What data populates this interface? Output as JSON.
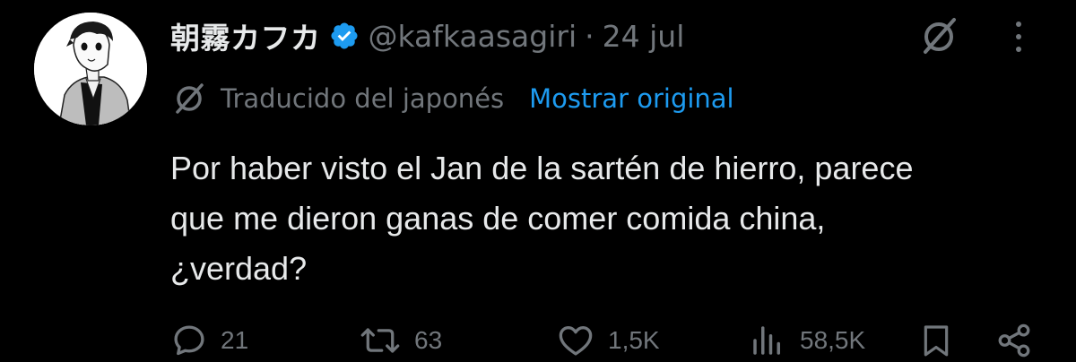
{
  "tweet": {
    "author": {
      "display_name": "朝霧カフカ",
      "handle": "@kafkaasagiri",
      "verified": true,
      "avatar": "avatar-illustration"
    },
    "separator": "·",
    "date": "24 jul",
    "translation": {
      "label": "Traducido del japonés",
      "show_original": "Mostrar original",
      "icon": "grok-icon"
    },
    "text_lines": [
      "Por haber visto el Jan de la sartén de hierro, parece",
      "que me dieron ganas de comer comida china,",
      "¿verdad?"
    ],
    "actions": {
      "replies": {
        "icon": "reply-icon",
        "count": "21"
      },
      "retweets": {
        "icon": "retweet-icon",
        "count": "63"
      },
      "likes": {
        "icon": "heart-icon",
        "count": "1,5K"
      },
      "views": {
        "icon": "analytics-icon",
        "count": "58,5K"
      },
      "bookmark": {
        "icon": "bookmark-icon"
      },
      "share": {
        "icon": "share-icon"
      }
    },
    "colors": {
      "background": "#000000",
      "text_primary": "#e7e9ea",
      "text_secondary": "#71767b",
      "accent": "#1d9bf0"
    }
  }
}
